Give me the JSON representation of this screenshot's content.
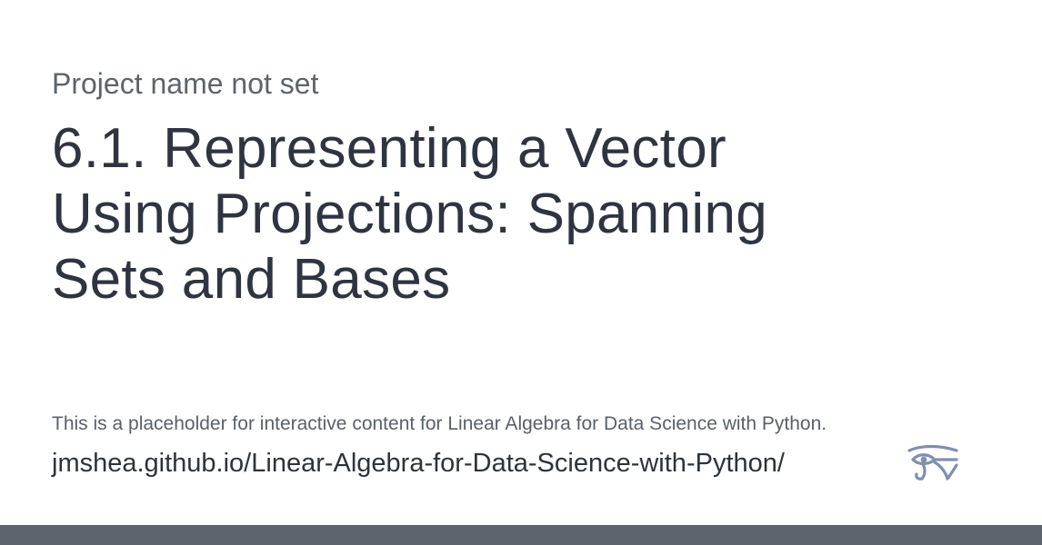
{
  "card": {
    "project_name": "Project name not set",
    "title": "6.1. Representing a Vector Using Projections: Spanning Sets and Bases",
    "description": "This is a placeholder for interactive content for Linear Algebra for Data Science with Python.",
    "url": "jmshea.github.io/Linear-Algebra-for-Data-Science-with-Python/",
    "logo_icon": "eye-of-horus-icon"
  },
  "colors": {
    "background": "#ffffff",
    "title_text": "#2e3440",
    "muted_text": "#5e646b",
    "logo": "#7f8fb0",
    "footer_bar": "#5d646d"
  }
}
